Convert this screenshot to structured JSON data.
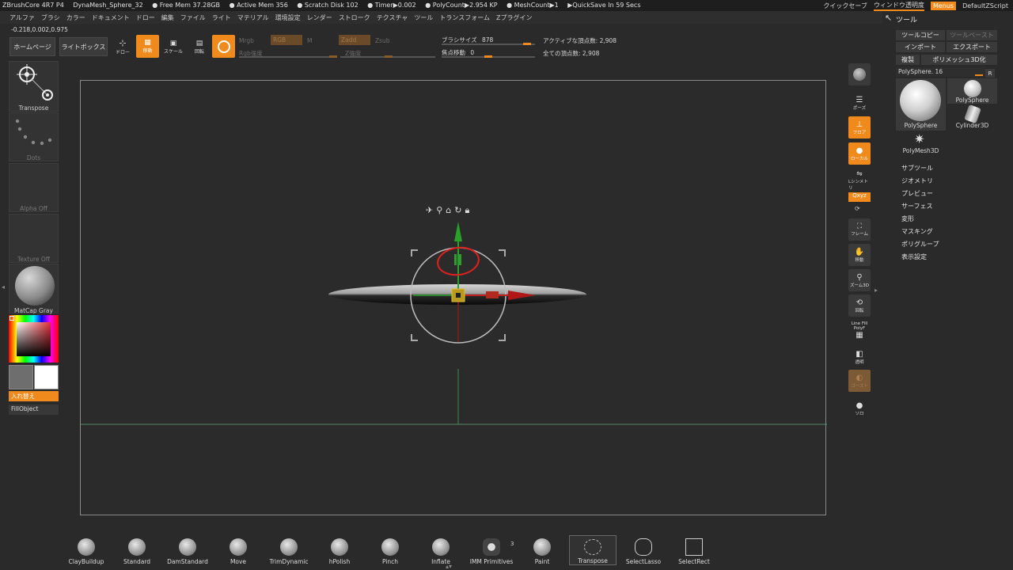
{
  "titlebar": {
    "status": [
      "ZBrushCore 4R7 P4",
      "DynaMesh_Sphere_32",
      "● Free Mem 37.28GB",
      "● Active Mem 356",
      "● Scratch Disk 102",
      "● Timer▶0.002",
      "● PolyCount▶2.954 KP",
      "● MeshCount▶1",
      "▶QuickSave In 59 Secs"
    ],
    "quicksave": "クイックセーブ",
    "window_transparency": "ウィンドウ透明度",
    "menus": "Menus",
    "script": "DefaultZScript"
  },
  "menubar": [
    "アルファ",
    "ブラシ",
    "カラー",
    "ドキュメント",
    "ドロー",
    "編集",
    "ファイル",
    "ライト",
    "マテリアル",
    "環境設定",
    "レンダー",
    "ストローク",
    "テクスチャ",
    "ツール",
    "トランスフォーム",
    "Zプラグイン"
  ],
  "coords": "-0.218,0.002,0.975",
  "shelf": {
    "home": "ホームページ",
    "lightbox": "ライトボックス",
    "draw": "ドロー",
    "move": "移動",
    "scale": "スケール",
    "rotate": "回転",
    "mrgb": "Mrgb",
    "rgb": "RGB",
    "m": "M",
    "rgb_intensity": "Rgb強度",
    "zadd": "Zadd",
    "zsub": "Zsub",
    "z_intensity": "Z強度",
    "brush_size_label": "ブラシサイズ",
    "brush_size": "878",
    "focal_label": "焦点移動",
    "focal": "0",
    "active_points": "アクティブな頂点数: 2,908",
    "total_points": "全ての頂点数: 2,908",
    "brush_size_fraction": 0.95,
    "focal_fraction": 0.5
  },
  "left": {
    "transpose": "Transpose",
    "dots": "Dots",
    "alpha": "Alpha Off",
    "texture": "Texture Off",
    "matcap": "MatCap Gray",
    "swap": "入れ替え",
    "fill": "FillObject"
  },
  "rightshelf": [
    "BPR",
    "ポーズ",
    "フロア",
    "ローカル",
    "Lシンメトリ",
    "Qxyz",
    "フレーム",
    "移動",
    "ズーム3D",
    "回転",
    "Line Fill PolyF",
    "透明",
    "ゴースト",
    "ソロ"
  ],
  "toolpanel": {
    "title": "ツール",
    "copy": "ツールコピー",
    "paste": "ツールペースト",
    "import": "インポート",
    "export": "エクスポート",
    "clone": "複製",
    "polymesh": "ポリメッシュ3D化",
    "current_tool": "PolySphere. 16",
    "r": "R",
    "tools": [
      "PolySphere",
      "PolySphere",
      "Cylinder3D",
      "PolyMesh3D"
    ],
    "sections": [
      "サブツール",
      "ジオメトリ",
      "プレビュー",
      "サーフェス",
      "変形",
      "マスキング",
      "ポリグループ",
      "表示設定"
    ]
  },
  "brushes": [
    "ClayBuildup",
    "Standard",
    "DamStandard",
    "Move",
    "TrimDynamic",
    "hPolish",
    "Pinch",
    "Inflate",
    "IMM Primitives",
    "Paint",
    "Transpose",
    "SelectLasso",
    "SelectRect"
  ],
  "imm_count": "3",
  "colors": {
    "accent": "#f08a1c",
    "bg": "#2a2a2a"
  }
}
